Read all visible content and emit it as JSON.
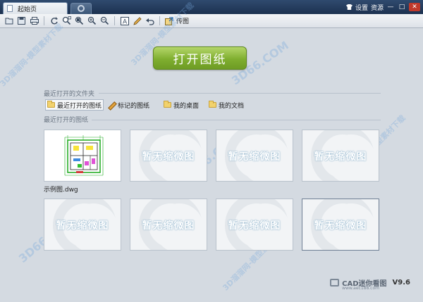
{
  "window": {
    "tab_title": "起始页",
    "controls": {
      "skin_label": "设置",
      "resource_label": "资源",
      "minimize": "—",
      "maximize": "□",
      "close": "✕"
    }
  },
  "toolbar": {
    "transfer_label": "传图"
  },
  "main": {
    "open_button": "打开图纸",
    "recent_folders_title": "最近打开的文件夹",
    "folders": [
      {
        "label": "最近打开的图纸",
        "icon": "folder-icon",
        "selected": true
      },
      {
        "label": "标记的图纸",
        "icon": "pencil-icon",
        "selected": false
      },
      {
        "label": "我的桌面",
        "icon": "folder-icon",
        "selected": false
      },
      {
        "label": "我的文档",
        "icon": "folder-icon",
        "selected": false
      }
    ],
    "recent_drawings_title": "最近打开的图纸",
    "drawings": [
      {
        "filename": "示例图.dwg",
        "has_thumbnail": true
      },
      {
        "placeholder": "暂无缩微图"
      },
      {
        "placeholder": "暂无缩微图"
      },
      {
        "placeholder": "暂无缩微图"
      },
      {
        "placeholder": "暂无缩微图"
      },
      {
        "placeholder": "暂无缩微图"
      },
      {
        "placeholder": "暂无缩微图"
      },
      {
        "placeholder": "暂无缩微图"
      }
    ]
  },
  "watermarks": {
    "site": "3D66.COM",
    "cn": "3D溜溜网-模型素材下载"
  },
  "brand": {
    "name": "CAD迷你看图",
    "version": "V9.6",
    "url": "www.aec188.com"
  },
  "colors": {
    "open_button": "#7fae2f",
    "background": "#d4dae1",
    "titlebar": "#1c3150"
  }
}
